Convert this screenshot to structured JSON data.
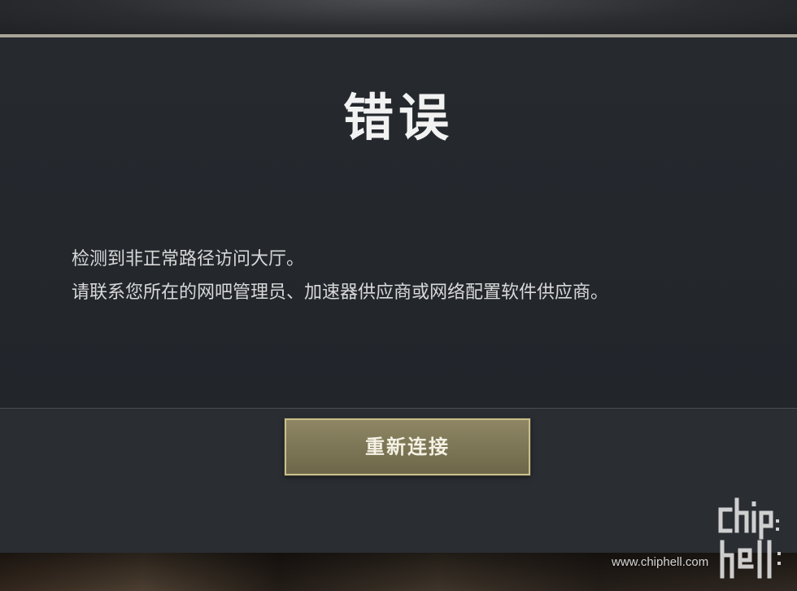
{
  "dialog": {
    "title": "错误",
    "message_lines": [
      "检测到非正常路径访问大厅。",
      "请联系您所在的网吧管理员、加速器供应商或网络配置软件供应商。"
    ],
    "reconnect_label": "重新连接"
  },
  "watermark": {
    "logo_text": "chip hell",
    "url": "www.chiphell.com"
  },
  "colors": {
    "dialog_background": "#22262b",
    "button_background": "#7d7657",
    "button_border": "#c9bf8c",
    "title_text": "#f2f2f2"
  }
}
